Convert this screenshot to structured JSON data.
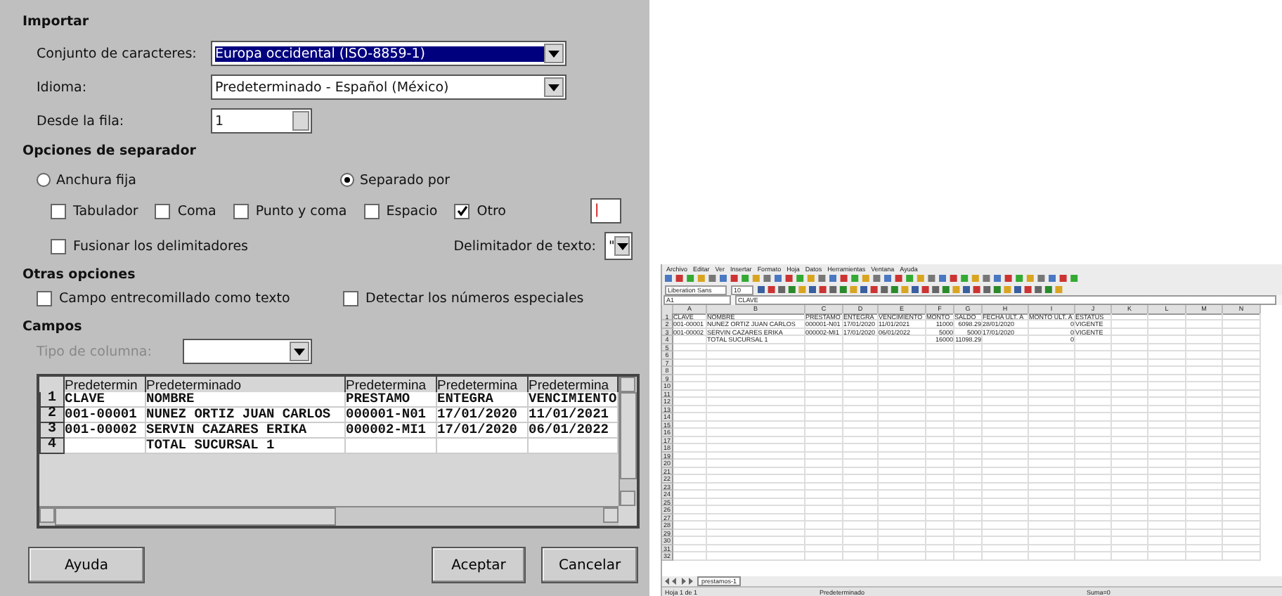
{
  "dialog": {
    "import": {
      "heading": "Importar",
      "fields": [
        {
          "kind": "dropdown",
          "label": "Conjunto de caracteres:",
          "value": "Europa occidental (ISO-8859-1)",
          "selected": true
        },
        {
          "kind": "dropdown",
          "label": "Idioma:",
          "value": "Predeterminado - Español (México)",
          "selected": false
        },
        {
          "kind": "spin",
          "label": "Desde la fila:",
          "value": "1"
        }
      ]
    },
    "separator": {
      "heading": "Opciones de separador",
      "modes": [
        {
          "label": "Anchura fija",
          "selected": false
        },
        {
          "label": "Separado por",
          "selected": true
        }
      ],
      "delimiters": [
        {
          "label": "Tabulador",
          "checked": false
        },
        {
          "label": "Coma",
          "checked": false
        },
        {
          "label": "Punto y coma",
          "checked": false
        },
        {
          "label": "Espacio",
          "checked": false
        },
        {
          "label": "Otro",
          "checked": true
        }
      ],
      "other_value": "|",
      "merge": {
        "label": "Fusionar los delimitadores",
        "checked": false
      },
      "text_delimiter": {
        "label": "Delimitador de texto:",
        "value": "\""
      }
    },
    "other_options": {
      "heading": "Otras opciones",
      "options": [
        {
          "label": "Campo entrecomillado como texto",
          "checked": false
        },
        {
          "label": "Detectar los números especiales",
          "checked": false
        }
      ]
    },
    "fields": {
      "heading": "Campos",
      "column_type": {
        "label": "Tipo de columna:",
        "disabled": true
      },
      "columns": [
        "Predetermin",
        "Predeterminado",
        "Predetermina",
        "Predetermina",
        "Predetermina"
      ],
      "rows": [
        {
          "number": "1",
          "cells": [
            "CLAVE",
            "NOMBRE",
            "PRESTAMO",
            "ENTEGRA",
            "VENCIMIENTO"
          ]
        },
        {
          "number": "2",
          "cells": [
            "001-00001",
            "NUNEZ ORTIZ JUAN CARLOS",
            "000001-N01",
            "17/01/2020",
            "11/01/2021"
          ]
        },
        {
          "number": "3",
          "cells": [
            "001-00002",
            "SERVIN CAZARES ERIKA",
            "000002-MI1",
            "17/01/2020",
            "06/01/2022"
          ]
        },
        {
          "number": "4",
          "cells": [
            null,
            "TOTAL SUCURSAL 1",
            null,
            null,
            null
          ]
        }
      ]
    },
    "buttons": [
      {
        "label": "Ayuda"
      },
      {
        "label": "Aceptar"
      },
      {
        "label": "Cancelar"
      }
    ]
  },
  "spreadsheet": {
    "menu": [
      "Archivo",
      "Editar",
      "Ver",
      "Insertar",
      "Formato",
      "Hoja",
      "Datos",
      "Herramientas",
      "Ventana",
      "Ayuda"
    ],
    "font_name": "Liberation Sans",
    "font_size": "10",
    "cell_ref": "A1",
    "formula": "CLAVE",
    "columns": [
      "A",
      "B",
      "C",
      "D",
      "E",
      "F",
      "G",
      "H",
      "I",
      "J",
      "K",
      "L",
      "M",
      "N"
    ],
    "rows": [
      {
        "number": "1",
        "cells": [
          "CLAVE",
          "NOMBRE",
          "PRESTAMO",
          "ENTEGRA",
          "VENCIMIENTO",
          "MONTO",
          "SALDO",
          "FECHA ULT. A",
          "MONTO ULT. A",
          "ESTATUS",
          null,
          null,
          null,
          null
        ]
      },
      {
        "number": "2",
        "cells": [
          "001-00001",
          "NUNEZ ORTIZ JUAN CARLOS",
          "000001-N01",
          "17/01/2020",
          "11/01/2021",
          "11000",
          "6098.29",
          "28/01/2020",
          "0",
          "VIGENTE",
          null,
          null,
          null,
          null
        ]
      },
      {
        "number": "3",
        "cells": [
          "001-00002",
          "SERVIN CAZARES ERIKA",
          "000002-MI1",
          "17/01/2020",
          "06/01/2022",
          "5000",
          "5000",
          "17/01/2020",
          "0",
          "VIGENTE",
          null,
          null,
          null,
          null
        ]
      },
      {
        "number": "4",
        "cells": [
          null,
          "TOTAL SUCURSAL 1",
          null,
          null,
          null,
          "16000",
          "11098.29",
          null,
          "0",
          null,
          null,
          null,
          null,
          null
        ]
      }
    ],
    "empty_rows": [
      "5",
      "6",
      "7",
      "8",
      "9",
      "10",
      "11",
      "12",
      "13",
      "14",
      "15",
      "16",
      "17",
      "18",
      "19",
      "20",
      "21",
      "22",
      "23",
      "24",
      "25",
      "26",
      "27",
      "28",
      "29",
      "30",
      "31",
      "32"
    ],
    "sheet_tab": "prestamos-1",
    "status": [
      "Hoja 1 de 1",
      "Predeterminado",
      "Suma=0"
    ]
  }
}
